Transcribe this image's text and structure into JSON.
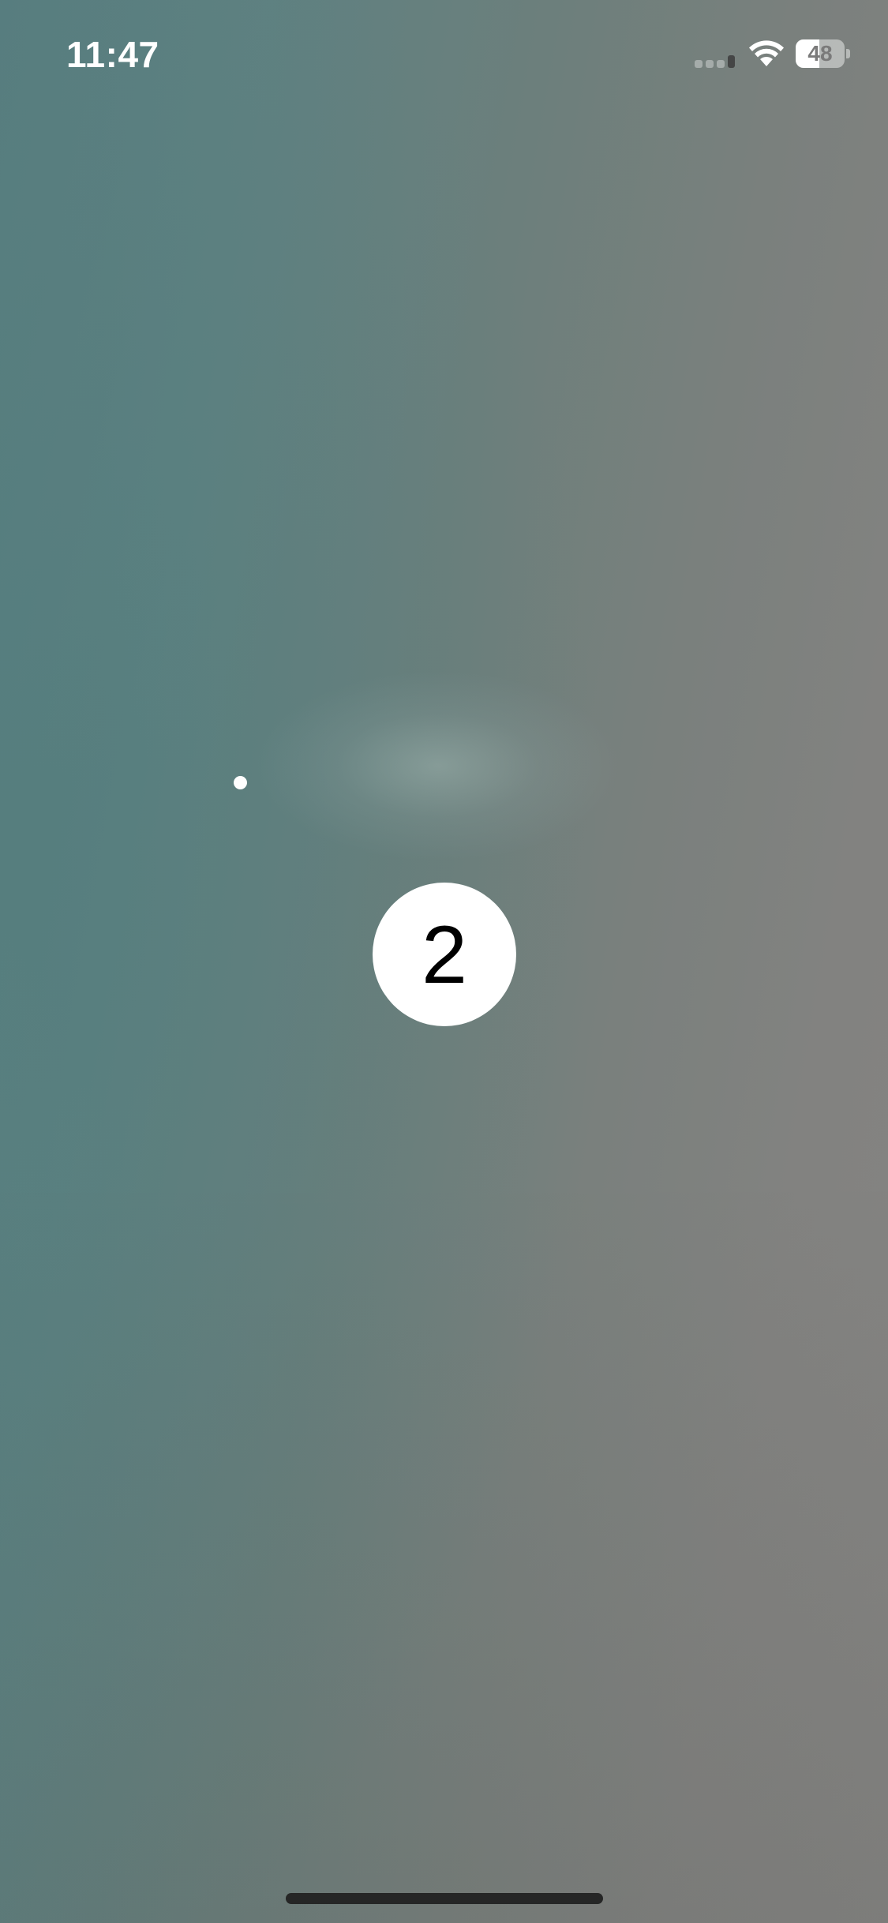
{
  "status_bar": {
    "time": "11:47",
    "battery_level": "48",
    "battery_fraction": 0.48
  },
  "countdown": {
    "value": "2"
  },
  "colors": {
    "indicator_background": "#ffffff",
    "indicator_text": "#000000",
    "home_indicator": "#262626"
  },
  "icons": {
    "cellular": "cellular-signal-icon",
    "wifi": "wifi-icon",
    "battery": "battery-icon"
  }
}
